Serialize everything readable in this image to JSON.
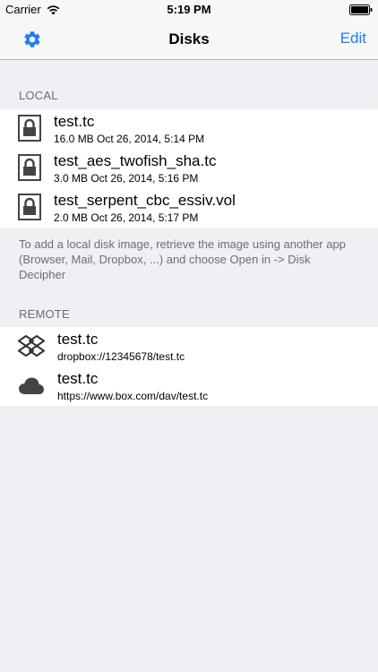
{
  "status_bar": {
    "carrier": "Carrier",
    "time": "5:19 PM",
    "icons": [
      "wifi-icon",
      "battery-icon"
    ]
  },
  "nav": {
    "title": "Disks",
    "edit_label": "Edit",
    "settings_icon": "gear-icon",
    "accent_color": "#1a7ef5"
  },
  "local": {
    "header": "LOCAL",
    "items": [
      {
        "name": "test.tc",
        "detail": "16.0 MB  Oct 26, 2014, 5:14 PM",
        "icon": "lock-icon"
      },
      {
        "name": "test_aes_twofish_sha.tc",
        "detail": "3.0 MB  Oct 26, 2014, 5:16 PM",
        "icon": "lock-icon"
      },
      {
        "name": "test_serpent_cbc_essiv.vol",
        "detail": "2.0 MB  Oct 26, 2014, 5:17 PM",
        "icon": "lock-icon"
      }
    ],
    "footer": "To add a local disk image, retrieve the image using another app (Browser, Mail, Dropbox, ...) and choose Open in -> Disk Decipher"
  },
  "remote": {
    "header": "REMOTE",
    "items": [
      {
        "name": "test.tc",
        "detail": "dropbox://12345678/test.tc",
        "icon": "dropbox-icon"
      },
      {
        "name": "test.tc",
        "detail": "https://www.box.com/dav/test.tc",
        "icon": "cloud-icon"
      }
    ]
  }
}
